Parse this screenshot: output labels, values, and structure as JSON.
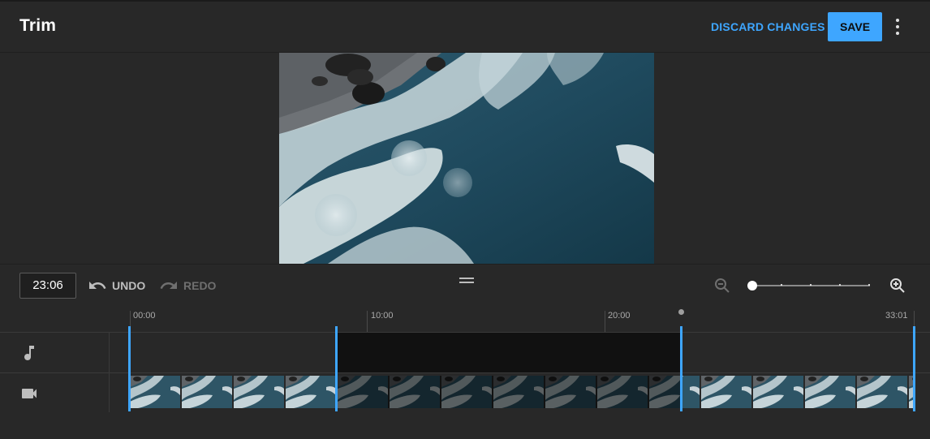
{
  "header": {
    "title": "Trim",
    "discard_label": "DISCARD CHANGES",
    "save_label": "SAVE",
    "more_icon": "more-vert-icon"
  },
  "colors": {
    "accent": "#3ea6ff",
    "background": "#282828",
    "cut_region": "#111111"
  },
  "preview": {
    "thumbnail": "ocean-waves-aerial-image"
  },
  "controls": {
    "time_value": "23:06",
    "undo_label": "UNDO",
    "redo_label": "REDO",
    "undo_icon": "undo-icon",
    "redo_icon": "redo-icon",
    "zoom_out_icon": "zoom-out-icon",
    "zoom_in_icon": "zoom-in-icon",
    "zoom_level_steps": 5,
    "zoom_level_selected": 0
  },
  "timeline": {
    "ticks": [
      "00:00",
      "10:00",
      "20:00",
      "33:01"
    ],
    "tracks": [
      {
        "name": "audio",
        "icon": "music-note-icon"
      },
      {
        "name": "video",
        "icon": "videocam-icon"
      }
    ],
    "frame_count": 16
  }
}
